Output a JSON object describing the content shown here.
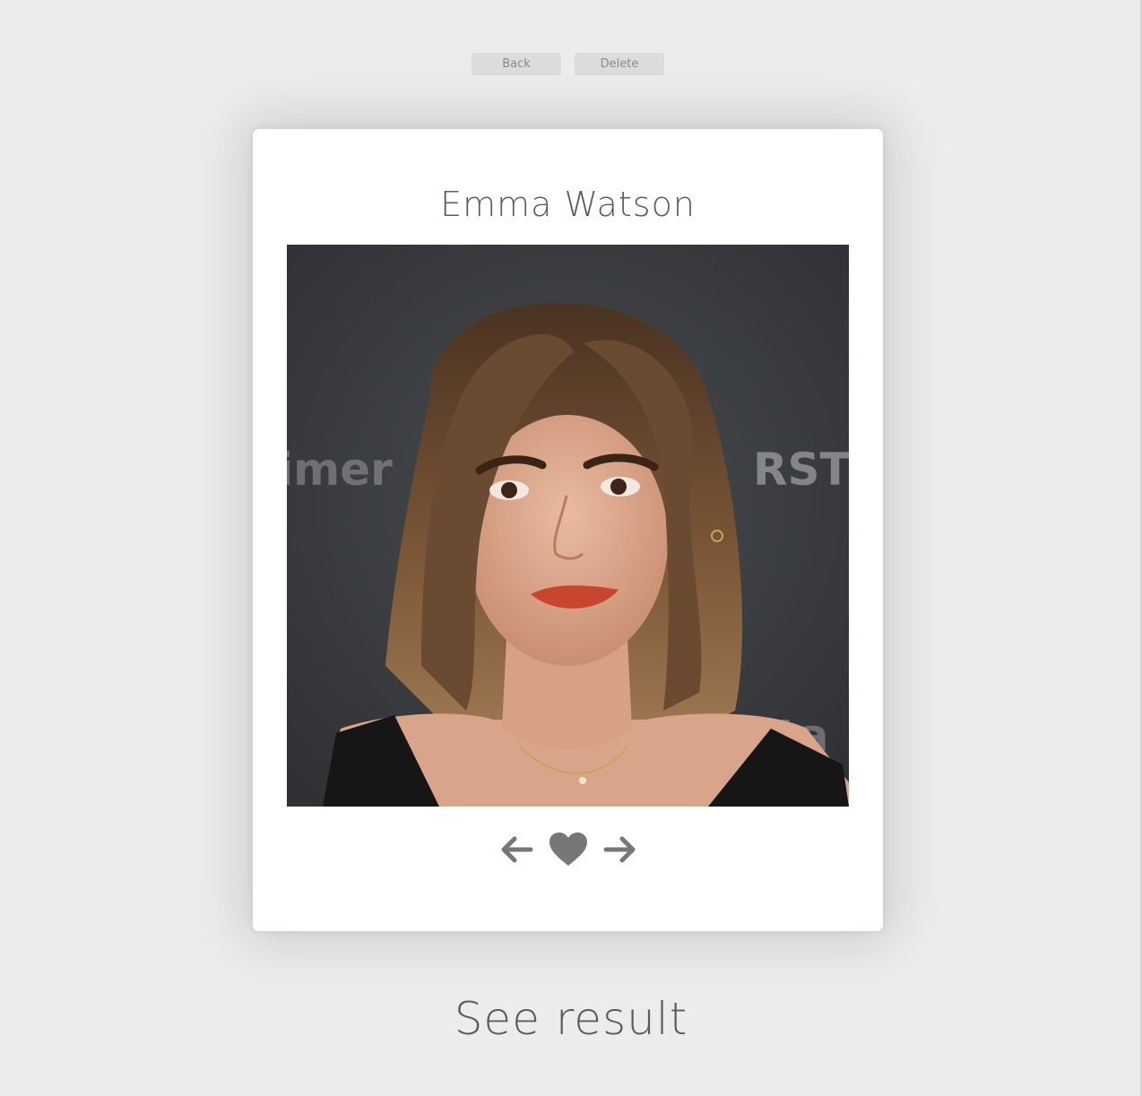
{
  "toolbar": {
    "back_label": "Back",
    "delete_label": "Delete"
  },
  "card": {
    "person_name": "Emma Watson",
    "photo_alt": "Emma Watson"
  },
  "controls": {
    "prev_icon": "arrow-left-icon",
    "like_icon": "heart-icon",
    "next_icon": "arrow-right-icon",
    "icon_color": "#777777"
  },
  "footer": {
    "see_result_label": "See result"
  },
  "colors": {
    "background": "#ececec",
    "card": "#ffffff",
    "text": "#5c5c5c",
    "button_bg": "#dcdcdc",
    "button_text": "#8a8a8a"
  }
}
